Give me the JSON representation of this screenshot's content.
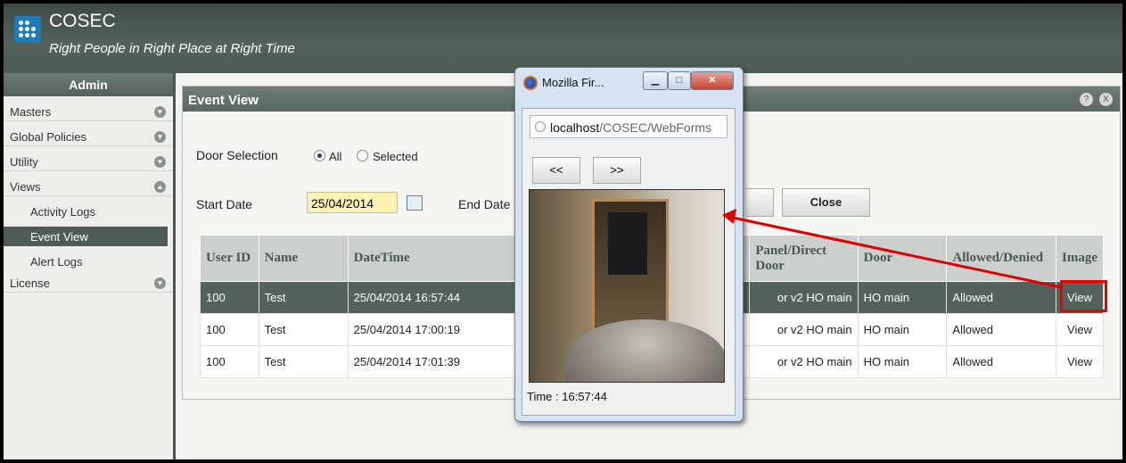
{
  "header": {
    "title": "COSEC",
    "tagline": "Right People in Right Place at Right Time"
  },
  "sidebar": {
    "title": "Admin",
    "menu": [
      {
        "label": "Masters"
      },
      {
        "label": "Global Policies"
      },
      {
        "label": "Utility"
      },
      {
        "label": "Views"
      }
    ],
    "views_sub": [
      {
        "label": "Activity Logs"
      },
      {
        "label": "Event View",
        "active": true
      },
      {
        "label": "Alert Logs"
      }
    ],
    "license": {
      "label": "License"
    }
  },
  "panel": {
    "title": "Event View",
    "help_icon": "?",
    "close_icon": "X",
    "door_selection_label": "Door Selection",
    "radio_all": "All",
    "radio_selected": "Selected",
    "start_date_label": "Start Date",
    "start_date": "25/04/2014",
    "end_date_label": "End Date",
    "close_button": "Close"
  },
  "table": {
    "headers": [
      "User ID",
      "Name",
      "DateTime",
      "Panel/Direct Door",
      "Door",
      "Allowed/Denied",
      "Image"
    ],
    "rows": [
      {
        "user_id": "100",
        "name": "Test",
        "datetime": "25/04/2014 16:57:44",
        "panel": "or v2 HO main",
        "door": "HO main",
        "status": "Allowed",
        "image": "View"
      },
      {
        "user_id": "100",
        "name": "Test",
        "datetime": "25/04/2014 17:00:19",
        "panel": "or v2 HO main",
        "door": "HO main",
        "status": "Allowed",
        "image": "View"
      },
      {
        "user_id": "100",
        "name": "Test",
        "datetime": "25/04/2014 17:01:39",
        "panel": "or v2 HO main",
        "door": "HO main",
        "status": "Allowed",
        "image": "View"
      }
    ]
  },
  "popup": {
    "title": "Mozilla Fir...",
    "url_host": "localhost",
    "url_path": "/COSEC/WebForms",
    "prev_label": "<<",
    "next_label": ">>",
    "time_text": "Time : 16:57:44"
  },
  "colors": {
    "header_bg": "#4d5a54",
    "selected_row": "#55625c",
    "date_input_bg": "#fdf3b0",
    "annotation": "#e00000"
  }
}
